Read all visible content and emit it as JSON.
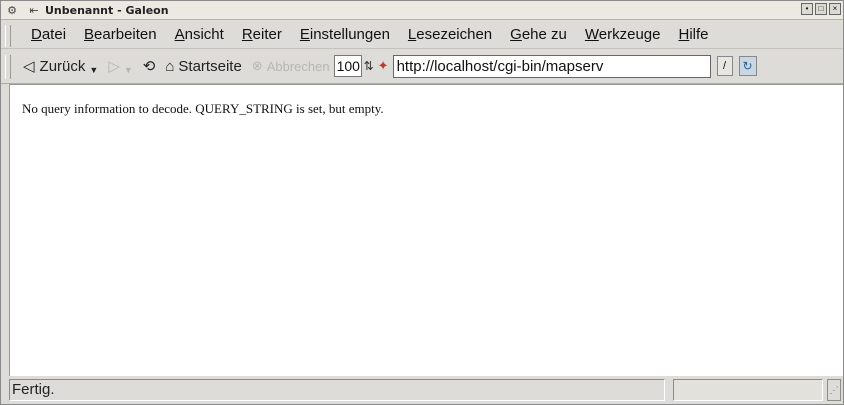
{
  "window": {
    "title": "Unbenannt - Galeon",
    "title_prefix_icon": "galeon-app-icon"
  },
  "menu": {
    "items": [
      {
        "label_first": "D",
        "label_rest": "atei"
      },
      {
        "label_first": "B",
        "label_rest": "earbeiten"
      },
      {
        "label_first": "A",
        "label_rest": "nsicht"
      },
      {
        "label_first": "R",
        "label_rest": "eiter"
      },
      {
        "label_first": "E",
        "label_rest": "instellungen"
      },
      {
        "label_first": "L",
        "label_rest": "esezeichen"
      },
      {
        "label_first": "G",
        "label_rest": "ehe zu"
      },
      {
        "label_first": "W",
        "label_rest": "erkzeuge"
      },
      {
        "label_first": "H",
        "label_rest": "ilfe"
      }
    ]
  },
  "toolbar": {
    "back_label": "Zurück",
    "home_label": "Startseite",
    "stop_label": "Abbrechen",
    "zoom_value": "100",
    "url_value": "http://localhost/cgi-bin/mapserv"
  },
  "content": {
    "message": "No query information to decode. QUERY_STRING is set, but empty."
  },
  "status": {
    "text": "Fertig."
  },
  "colors": {
    "window_bg": "#dedcd8",
    "content_bg": "#ffffff",
    "disabled_text": "#b8b6b1"
  }
}
